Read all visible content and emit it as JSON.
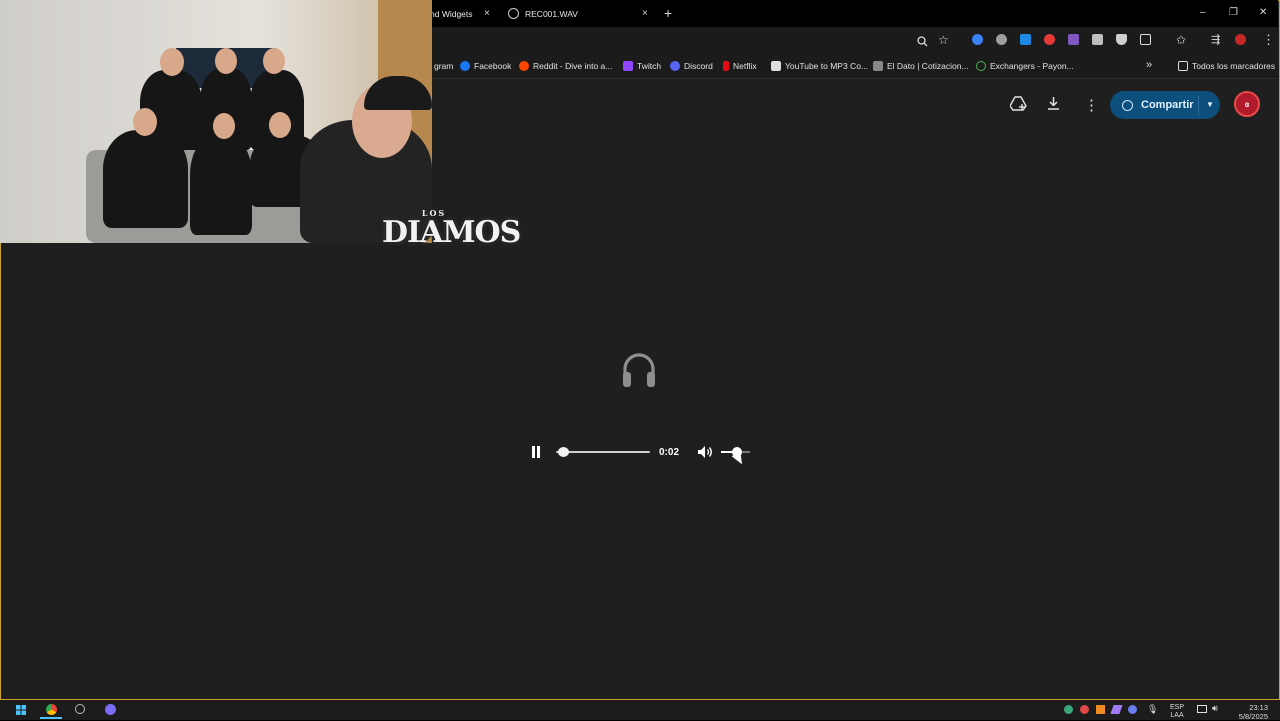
{
  "browser": {
    "tabs": [
      {
        "label": "nd Widgets",
        "close": "×"
      },
      {
        "label": "REC001.WAV",
        "close": "×"
      }
    ],
    "new_tab": "+",
    "window_controls": {
      "minimize": "–",
      "maximize": "❐",
      "close": "✕"
    }
  },
  "bookmarks": {
    "items": [
      {
        "label": "gram",
        "color": "#c13584"
      },
      {
        "label": "Facebook",
        "color": "#1877f2"
      },
      {
        "label": "Reddit - Dive into a...",
        "color": "#ff4500"
      },
      {
        "label": "Twitch",
        "color": "#9146ff"
      },
      {
        "label": "Discord",
        "color": "#5865f2"
      },
      {
        "label": "Netflix",
        "color": "#e50914"
      },
      {
        "label": "YouTube to MP3 Co...",
        "color": "#dddddd"
      },
      {
        "label": "El Dato | Cotizacion...",
        "color": "#888888"
      },
      {
        "label": "Exchangers - Payon...",
        "color": "#4caf50"
      }
    ],
    "more": "»",
    "all_bookmarks": "Todos los marcadores"
  },
  "drive": {
    "share_label": "Compartir",
    "avatar_text": "ɞ",
    "accent": "#0c4f7d"
  },
  "overlay": {
    "logo_small": "LOS",
    "logo_big": "DIAMOS"
  },
  "player": {
    "state": "playing",
    "elapsed": "0:02",
    "progress": 0.02,
    "volume": 0.4
  },
  "taskbar": {
    "lang_top": "ESP",
    "lang_bottom": "LAA",
    "time": "23:13",
    "date": "5/8/2025"
  }
}
